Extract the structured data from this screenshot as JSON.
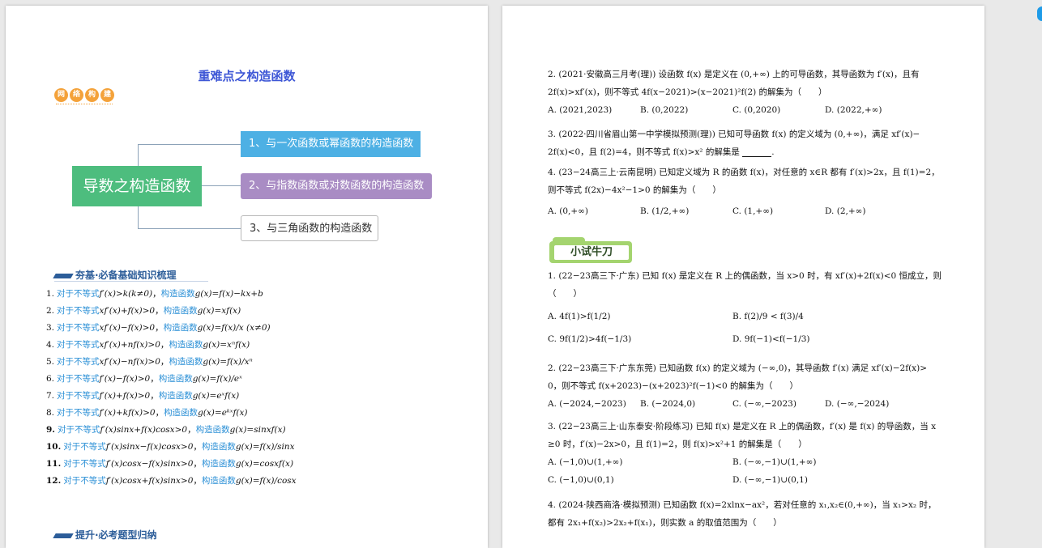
{
  "left": {
    "title": "重难点之构造函数",
    "badge": [
      "网",
      "络",
      "构",
      "建"
    ],
    "mindmap": {
      "root": "导数之构造函数",
      "branches": [
        "1、与一次函数或幂函数的构造函数",
        "2、与指数函数或对数函数的构造函数",
        "3、与三角函数的构造函数"
      ]
    },
    "section1": "夯基·必备基础知识梳理",
    "formulas": [
      {
        "num": "1.",
        "cond": "f′(x)>k(k≠0)",
        "func": "g(x)=f(x)−kx+b"
      },
      {
        "num": "2.",
        "cond": "xf′(x)+f(x)>0",
        "func": "g(x)=xf(x)"
      },
      {
        "num": "3.",
        "cond": "xf′(x)−f(x)>0",
        "func": "g(x)=f(x)/x (x≠0)"
      },
      {
        "num": "4.",
        "cond": "xf′(x)+nf(x)>0",
        "func": "g(x)=xⁿf(x)"
      },
      {
        "num": "5.",
        "cond": "xf′(x)−nf(x)>0",
        "func": "g(x)=f(x)/xⁿ"
      },
      {
        "num": "6.",
        "cond": "f′(x)−f(x)>0",
        "func": "g(x)=f(x)/eˣ"
      },
      {
        "num": "7.",
        "cond": "f′(x)+f(x)>0",
        "func": "g(x)=eˣf(x)"
      },
      {
        "num": "8.",
        "cond": "f′(x)+kf(x)>0",
        "func": "g(x)=eᵏˣf(x)"
      },
      {
        "num": "9.",
        "cond": "f′(x)sinx+f(x)cosx>0",
        "func": "g(x)=sinxf(x)"
      },
      {
        "num": "10.",
        "cond": "f′(x)sinx−f(x)cosx>0",
        "func": "g(x)=f(x)/sinx"
      },
      {
        "num": "11.",
        "cond": "f′(x)cosx−f(x)sinx>0",
        "func": "g(x)=cosxf(x)"
      },
      {
        "num": "12.",
        "cond": "f′(x)cosx+f(x)sinx>0",
        "func": "g(x)=f(x)/cosx"
      }
    ],
    "prefix_text": "对于不等式",
    "mid_text": "构造函数",
    "section2": "提升·必考题型归纳"
  },
  "right": {
    "q2": {
      "line1": "2. (2021·安徽高三月考(理)) 设函数 f(x) 是定义在 (0,+∞) 上的可导函数，其导函数为 f′(x)，且有",
      "line2": "2f(x)>xf′(x)，则不等式 4f(x−2021)>(x−2021)²f(2) 的解集为（　　）",
      "opts": [
        "A. (2021,2023)",
        "B. (0,2022)",
        "C. (0,2020)",
        "D. (2022,+∞)"
      ]
    },
    "q3": {
      "line1": "3. (2022·四川省眉山第一中学模拟预测(理)) 已知可导函数 f(x) 的定义域为 (0,+∞)，满足 xf′(x)−",
      "line2": "2f(x)<0，且 f(2)=4，则不等式 f(x)>x² 的解集是"
    },
    "q4": {
      "line1": "4. (23−24高三上·云南昆明) 已知定义域为 R 的函数 f(x)，对任意的 x∈R 都有 f′(x)>2x，且 f(1)=2，",
      "line2": "则不等式 f(2x)−4x²−1>0 的解集为（　　）",
      "opts": [
        "A. (0,+∞)",
        "B. (1/2,+∞)",
        "C. (1,+∞)",
        "D. (2,+∞)"
      ]
    },
    "tab": "小试牛刀",
    "p1": {
      "line1": "1. (22−23高三下·广东) 已知 f(x) 是定义在 R 上的偶函数，当 x>0 时，有 xf′(x)+2f(x)<0 恒成立，则",
      "line2": "（　　）",
      "opts": [
        "A. 4f(1)>f(1/2)",
        "B. f(2)/9 < f(3)/4",
        "C. 9f(1/2)>4f(−1/3)",
        "D. 9f(−1)<f(−1/3)"
      ]
    },
    "p2": {
      "line1": "2. (22−23高三下·广东东莞) 已知函数 f(x) 的定义域为 (−∞,0)，其导函数 f′(x) 满足 xf′(x)−2f(x)>",
      "line2": "0，则不等式 f(x+2023)−(x+2023)²f(−1)<0 的解集为（　　）",
      "opts": [
        "A. (−2024,−2023)",
        "B. (−2024,0)",
        "C. (−∞,−2023)",
        "D. (−∞,−2024)"
      ]
    },
    "p3": {
      "line1": "3. (22−23高三上·山东泰安·阶段练习) 已知 f(x) 是定义在 R 上的偶函数，f′(x) 是 f(x) 的导函数，当 x",
      "line2": "≥0 时，f′(x)−2x>0，且 f(1)=2，则 f(x)>x²+1 的解集是（　　）",
      "opts": [
        "A. (−1,0)∪(1,+∞)",
        "B. (−∞,−1)∪(1,+∞)",
        "C. (−1,0)∪(0,1)",
        "D. (−∞,−1)∪(0,1)"
      ]
    },
    "p4": {
      "line1": "4. (2024·陕西商洛·模拟预测) 已知函数 f(x)=2xlnx−ax²，若对任意的 x₁,x₂∈(0,+∞)，当 x₁>x₂ 时，",
      "line2": "都有 2x₁+f(x₂)>2x₂+f(x₁)，则实数 a 的取值范围为（　　）"
    }
  }
}
